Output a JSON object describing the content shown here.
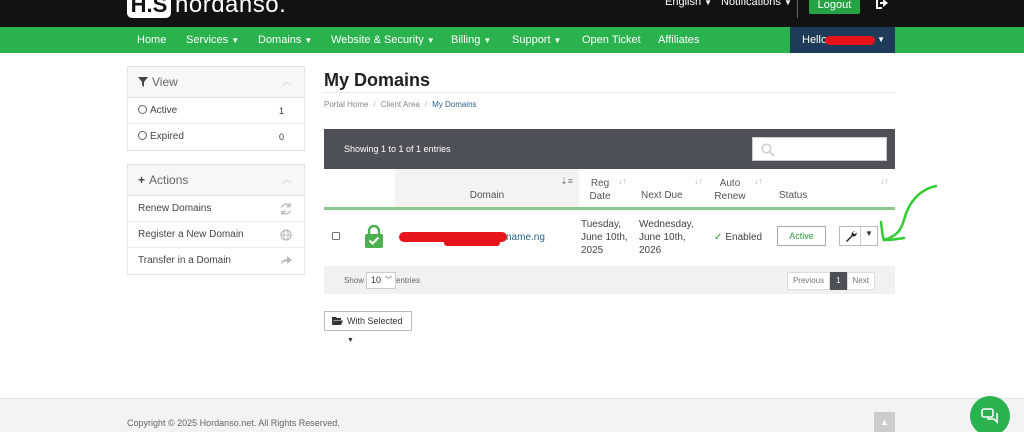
{
  "header": {
    "logo_mark": "H.S",
    "logo_text": "hordanso.",
    "language": "English",
    "notifications": "Notifications",
    "logout": "Logout"
  },
  "nav": {
    "items": [
      "Home",
      "Services",
      "Domains",
      "Website & Security",
      "Billing",
      "Support",
      "Open Ticket",
      "Affiliates"
    ],
    "user_greeting": "Hello"
  },
  "sidebar": {
    "view": {
      "title": "View",
      "items": [
        {
          "label": "Active",
          "count": "1"
        },
        {
          "label": "Expired",
          "count": "0"
        }
      ]
    },
    "actions": {
      "title": "Actions",
      "items": [
        {
          "label": "Renew Domains",
          "icon": "refresh-icon"
        },
        {
          "label": "Register a New Domain",
          "icon": "globe-icon"
        },
        {
          "label": "Transfer in a Domain",
          "icon": "share-icon"
        }
      ]
    }
  },
  "main": {
    "title": "My Domains",
    "breadcrumb": [
      "Portal Home",
      "Client Area",
      "My Domains"
    ],
    "table": {
      "showing": "Showing 1 to 1 of 1 entries",
      "columns": [
        "Domain",
        "Reg Date",
        "Next Due",
        "Auto Renew",
        "Status"
      ],
      "rows": [
        {
          "domain_suffix": "name.ng",
          "reg_date": "Tuesday, June 10th, 2025",
          "next_due": "Wednesday, June 10th, 2026",
          "auto_renew": "Enabled",
          "status": "Active"
        }
      ],
      "length_label_pre": "Show",
      "length_value": "10",
      "length_label_post": "entries",
      "pager": {
        "previous": "Previous",
        "current": "1",
        "next": "Next"
      }
    },
    "with_selected": "With Selected"
  },
  "footer": {
    "copyright": "Copyright © 2025 Hordanso.net. All Rights Reserved."
  },
  "colors": {
    "brand_green": "#2ab24f",
    "dark_bar": "#4d5157",
    "user_menu": "#1f3b5a",
    "redaction": "#e8141c"
  }
}
